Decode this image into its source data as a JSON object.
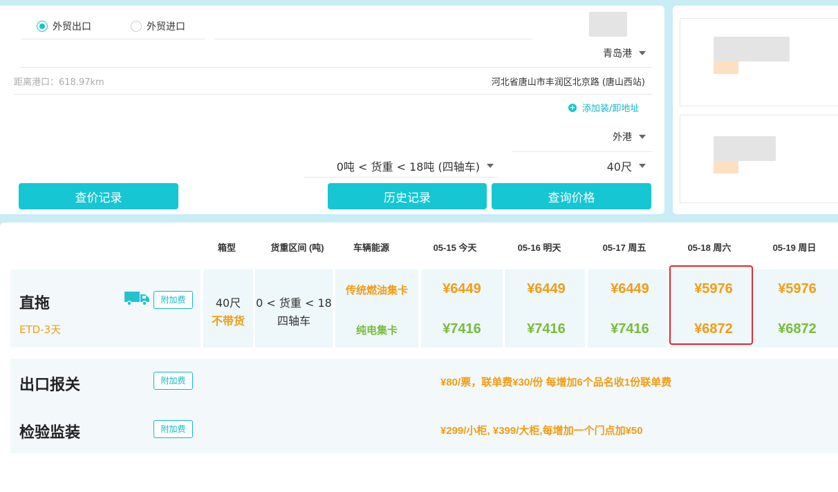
{
  "query": {
    "trade_type": [
      {
        "label": "外贸出口",
        "checked": true
      },
      {
        "label": "外贸进口",
        "checked": false
      }
    ],
    "port": "青岛港",
    "distance": "距离港口：618.97km",
    "address": "河北省唐山市丰润区北京路 (唐山西站)",
    "add_address": "添加装/卸地址",
    "terminal": "外港",
    "weight_range": "0吨 < 货重 < 18吨 (四轴车)",
    "container": "40尺",
    "buttons": {
      "price_record": "查价记录",
      "history": "历史记录",
      "query_price": "查询价格"
    }
  },
  "table": {
    "headers": {
      "box_type": "箱型",
      "weight_range": "货重区间 (吨)",
      "energy": "车辆能源",
      "dates": [
        "05-15 今天",
        "05-16 明天",
        "05-17 周五",
        "05-18 周六",
        "05-19 周日"
      ]
    },
    "drayage": {
      "title": "直拖",
      "etd": "ETD-3天",
      "surcharge": "附加费",
      "box": "40尺",
      "no_cargo": "不带货",
      "weight": "0 < 货重 < 18",
      "axle": "四轴车",
      "fuel_label": "传统燃油集卡",
      "electric_label": "纯电集卡",
      "fuel_prices": [
        "¥6449",
        "¥6449",
        "¥6449",
        "¥5976",
        "¥5976"
      ],
      "electric_prices": [
        "¥7416",
        "¥7416",
        "¥7416",
        "¥6872",
        "¥6872"
      ]
    },
    "customs": {
      "title": "出口报关",
      "surcharge": "附加费",
      "note": "¥80/票，联单费¥30/份   每增加6个品名收1份联单费"
    },
    "inspection": {
      "title": "检验监装",
      "surcharge": "附加费",
      "note": "¥299/小柜, ¥399/大柜,每增加一个门点加¥50"
    }
  },
  "colors": {
    "accent": "#16c6d2",
    "price_orange": "#f39c12",
    "price_green": "#76bd3a",
    "highlight_red": "#e0262a"
  }
}
